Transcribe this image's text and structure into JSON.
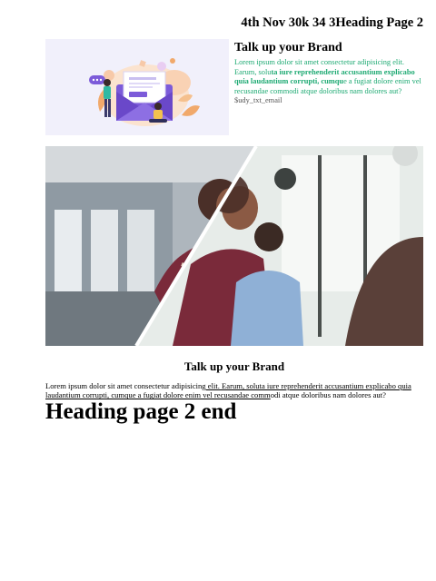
{
  "header": {
    "title": "4th Nov 30k 34 3Heading Page 2"
  },
  "feature_block": {
    "title": "Talk up your Brand",
    "text_intro": "Lorem ipsum dolor sit amet consectetur adipisicing elit. Earum, solu",
    "text_bold": "ta iure reprehenderit accusantium explicabo quia laudantium corrupti, cumqu",
    "text_rest": "e a fugiat dolore enim vel recusandae commodi atque doloribus nam dolores aut?",
    "text_tail": "$udy_txt_email"
  },
  "article": {
    "title": "Talk up your Brand",
    "text_plain": "Lorem ipsum dolor sit amet consectetur adipisicing",
    "text_underlined": " elit. Earum, soluta iure reprehenderit accusantium explicabo quia laudantium corrupti, cumque a fugiat dolore enim vel recusandae comm",
    "text_end": "odi atque doloribus nam dolores aut?"
  },
  "footer_heading": "Heading page 2 end",
  "colors": {
    "accent_text": "#1eaa73",
    "illustration_bg": "#f1f0fb",
    "envelope": "#7c5bd9",
    "sweater": "#7a2a3a"
  }
}
